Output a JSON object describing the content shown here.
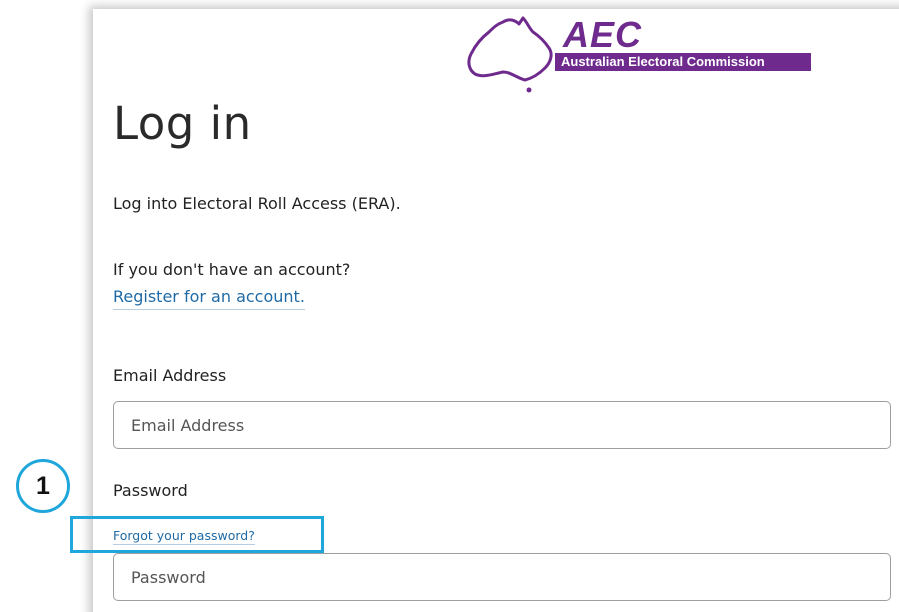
{
  "brand": {
    "logo_abbr": "AEC",
    "logo_full": "Australian Electoral Commission",
    "color": "#6f2a8d"
  },
  "page": {
    "title": "Log in",
    "intro": "Log into Electoral Roll Access (ERA).",
    "no_account": "If you don't have an account?",
    "register_link": "Register for an account."
  },
  "form": {
    "email_label": "Email Address",
    "email_placeholder": "Email Address",
    "password_label": "Password",
    "forgot_link": "Forgot your password?",
    "password_placeholder": "Password"
  },
  "annotation": {
    "step_number": "1",
    "color": "#1fa6db"
  }
}
